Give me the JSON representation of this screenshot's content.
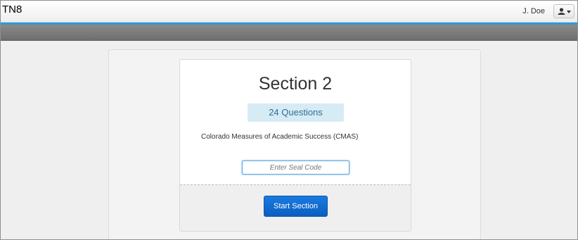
{
  "app": {
    "title": "TN8"
  },
  "user": {
    "name": "J. Doe",
    "menu_icon": "user-icon"
  },
  "section": {
    "title": "Section 2",
    "question_count_label": "24 Questions",
    "description": "Colorado Measures of Academic Success (CMAS)",
    "seal_placeholder": "Enter Seal Code",
    "start_label": "Start Section"
  },
  "colors": {
    "accent": "#2a9ad6",
    "primary_button": "#0a6fd6",
    "badge_bg": "#d7ebf5",
    "badge_text": "#2b6f99"
  }
}
